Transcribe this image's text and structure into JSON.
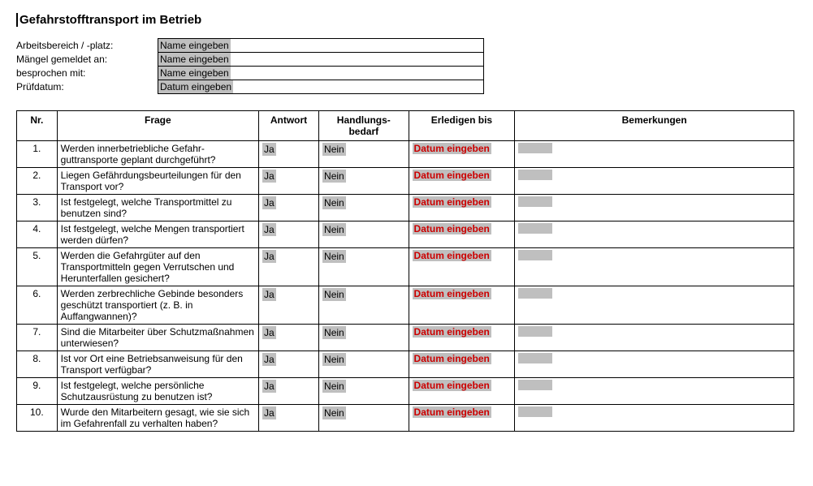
{
  "title": "Gefahrstofftransport im Betrieb",
  "info_rows": [
    {
      "label": "Arbeitsbereich / -platz:",
      "value": "Name eingeben"
    },
    {
      "label": "Mängel gemeldet an:",
      "value": "Name eingeben"
    },
    {
      "label": "besprochen mit:",
      "value": "Name eingeben"
    },
    {
      "label": "Prüfdatum:",
      "value": "Datum eingeben"
    }
  ],
  "columns": {
    "nr": "Nr.",
    "frage": "Frage",
    "antwort": "Antwort",
    "handlung_line1": "Handlungs-",
    "handlung_line2": "bedarf",
    "erledigen": "Erledigen bis",
    "bemerkungen": "Bemerkungen"
  },
  "default_answer": "Ja",
  "default_need": "Nein",
  "default_date": "Datum eingeben",
  "rows": [
    {
      "nr": "1.",
      "frage": "Werden innerbetriebliche Gefahr­guttransporte geplant durchge­führt?"
    },
    {
      "nr": "2.",
      "frage": "Liegen Gefährdungsbeurteilungen für den Transport vor?"
    },
    {
      "nr": "3.",
      "frage": "Ist festgelegt, welche Transportmit­tel zu benutzen sind?"
    },
    {
      "nr": "4.",
      "frage": "Ist festgelegt, welche Mengen transportiert werden dürfen?"
    },
    {
      "nr": "5.",
      "frage": "Werden die Gefahrgüter auf den Transportmitteln gegen Verrut­schen und Herunterfallen gesi­chert?"
    },
    {
      "nr": "6.",
      "frage": "Werden zerbrechliche Gebinde besonders geschützt transportiert (z. B. in Auffangwannen)?"
    },
    {
      "nr": "7.",
      "frage": "Sind die Mitarbeiter über Schutz­maßnahmen unterwiesen?"
    },
    {
      "nr": "8.",
      "frage": "Ist vor Ort eine Betriebsanweisung für den Transport verfügbar?"
    },
    {
      "nr": "9.",
      "frage": "Ist festgelegt, welche persönliche Schutzausrüstung zu benutzen ist?"
    },
    {
      "nr": "10.",
      "frage": "Wurde den Mitarbeitern gesagt, wie sie sich im Gefahrenfall zu verhalten haben?"
    }
  ]
}
